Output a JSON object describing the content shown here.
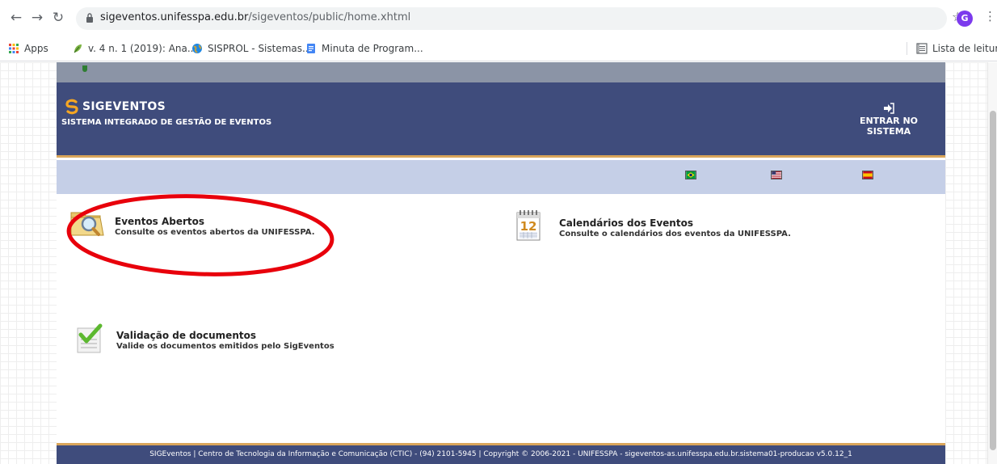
{
  "browser": {
    "url_host": "sigeventos.unifesspa.edu.br",
    "url_path": "/sigeventos/public/home.xhtml",
    "profile_initial": "G",
    "icons": {
      "back": "back-arrow-icon",
      "forward": "forward-arrow-icon",
      "reload": "reload-icon",
      "lock": "lock-icon",
      "star": "star-icon",
      "menu": "kebab-menu-icon"
    }
  },
  "bookmarks": {
    "items": [
      {
        "label": "Apps",
        "icon": "apps-grid-icon"
      },
      {
        "label": "v. 4 n. 1 (2019): Ana...",
        "icon": "leaf-icon"
      },
      {
        "label": "SISPROL - Sistemas...",
        "icon": "globe-icon"
      },
      {
        "label": "Minuta de Program...",
        "icon": "docs-icon"
      }
    ],
    "reading_list": "Lista de leitura"
  },
  "header": {
    "brand": "SIGEVENTOS",
    "subtitle": "SISTEMA INTEGRADO DE GESTÃO DE EVENTOS",
    "login_line1": "ENTRAR NO",
    "login_line2": "SISTEMA"
  },
  "languages": [
    "pt-br-flag-icon",
    "en-us-flag-icon",
    "es-flag-icon"
  ],
  "menu": {
    "eventos": {
      "title": "Eventos Abertos",
      "desc": "Consulte os eventos abertos da UNIFESSPA."
    },
    "calendarios": {
      "title": "Calendários dos Eventos",
      "desc": "Consulte o calendários dos eventos da UNIFESSPA.",
      "calendar_day": "12"
    },
    "validacao": {
      "title": "Validação de documentos",
      "desc": "Valide os documentos emitidos pelo SigEventos"
    }
  },
  "footer": {
    "text": "SIGEventos | Centro de Tecnologia da Informação e Comunicação (CTIC) - (94) 2101-5945 | Copyright © 2006-2021 - UNIFESSPA - sigeventos-as.unifesspa.edu.br.sistema01-producao v5.0.12_1"
  },
  "colors": {
    "header_bg": "#3f4c7c",
    "accent_line": "#d9a55a",
    "lang_bar": "#c5cfe7",
    "annotation": "#e8000b"
  }
}
